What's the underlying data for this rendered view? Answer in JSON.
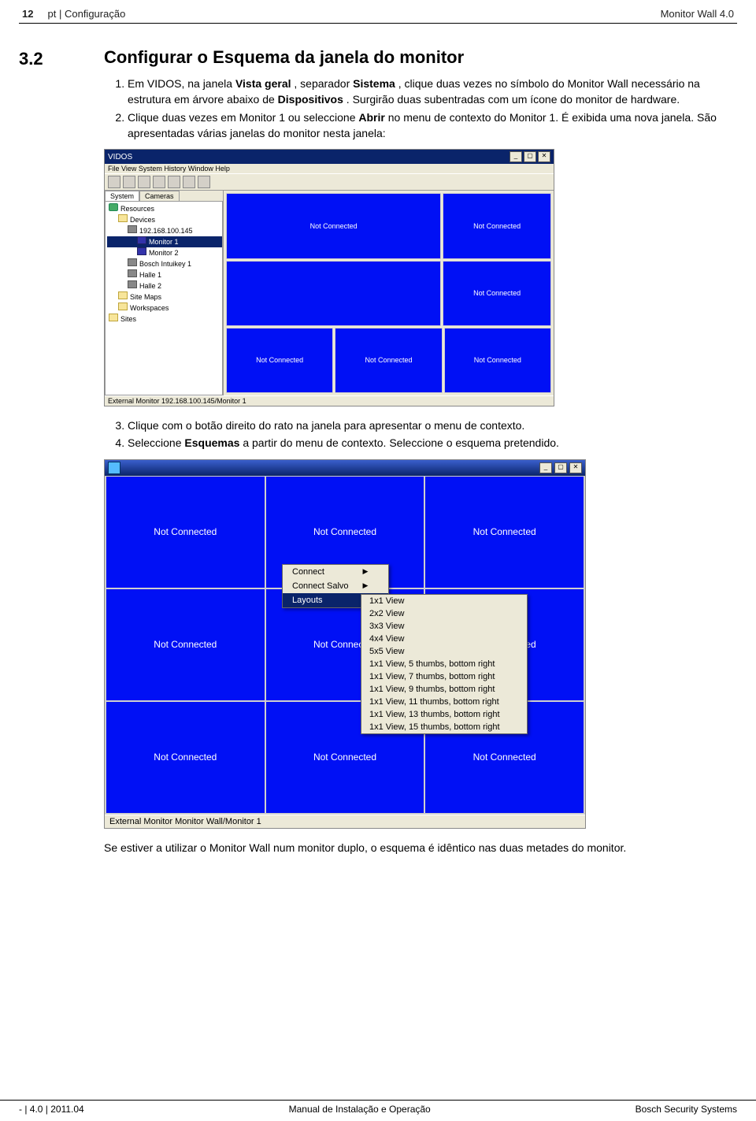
{
  "header": {
    "page_no": "12",
    "left_label": "pt | Configuração",
    "right_label": "Monitor Wall 4.0"
  },
  "section": {
    "number": "3.2",
    "title": "Configurar o Esquema da janela do monitor"
  },
  "steps_a": {
    "s1_pre": "Em VIDOS, na janela ",
    "s1_b1": "Vista geral",
    "s1_mid1": ", separador ",
    "s1_b2": "Sistema",
    "s1_mid2": ", clique duas vezes no símbolo do Monitor Wall necessário na estrutura em árvore abaixo de ",
    "s1_b3": "Dispositivos",
    "s1_post": ". Surgirão duas subentradas com um ícone do monitor de hardware.",
    "s2_pre": "Clique duas vezes em Monitor 1 ou seleccione ",
    "s2_b1": "Abrir",
    "s2_post": " no menu de contexto do Monitor 1. É exibida uma nova janela. São apresentadas várias janelas do monitor nesta janela:"
  },
  "steps_b": {
    "s3": "Clique com o botão direito do rato na janela para apresentar o menu de contexto.",
    "s4_pre": "Seleccione ",
    "s4_b1": "Esquemas",
    "s4_post": " a partir do menu de contexto. Seleccione o esquema pretendido."
  },
  "note": "Se estiver a utilizar o Monitor Wall num monitor duplo, o esquema é idêntico nas duas metades do monitor.",
  "footer": {
    "left": "- | 4.0 | 2011.04",
    "center": "Manual de Instalação e Operação",
    "right": "Bosch Security Systems"
  },
  "vidos": {
    "title": "VIDOS",
    "menu": "File  View  System  History  Window  Help",
    "tabs": {
      "system": "System",
      "cameras": "Cameras"
    },
    "tree": {
      "resources": "Resources",
      "devices": "Devices",
      "ip": "192.168.100.145",
      "mon1": "Monitor 1",
      "mon2": "Monitor 2",
      "bosch": "Bosch Intuikey 1",
      "halle1": "Halle 1",
      "halle2": "Halle 2",
      "sitemaps": "Site Maps",
      "workspaces": "Workspaces",
      "sites": "Sites"
    },
    "nc": "Not Connected",
    "status": "External Monitor 192.168.100.145/Monitor 1"
  },
  "layouts_fig": {
    "nc": "Not Connected",
    "status": "External Monitor Monitor Wall/Monitor 1"
  },
  "ctx_menu": {
    "connect": "Connect",
    "connect_salvo": "Connect Salvo",
    "layouts": "Layouts"
  },
  "layout_options": [
    "1x1 View",
    "2x2 View",
    "3x3 View",
    "4x4 View",
    "5x5 View",
    "1x1 View, 5 thumbs, bottom right",
    "1x1 View, 7 thumbs, bottom right",
    "1x1 View, 9 thumbs, bottom right",
    "1x1 View, 11 thumbs, bottom right",
    "1x1 View, 13 thumbs, bottom right",
    "1x1 View, 15 thumbs, bottom right"
  ]
}
